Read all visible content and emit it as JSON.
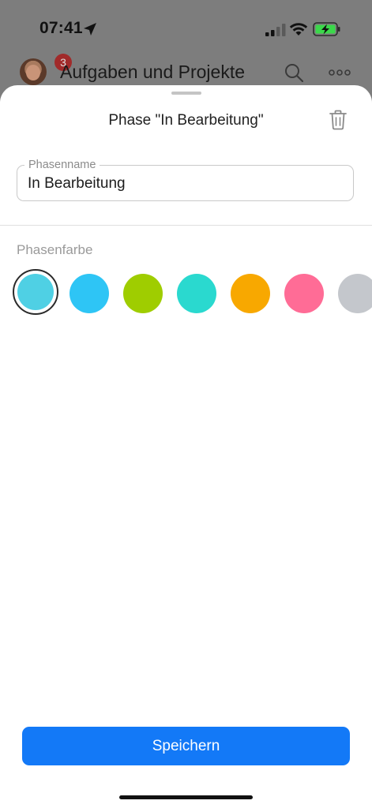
{
  "status_bar": {
    "time": "07:41"
  },
  "background_header": {
    "title": "Aufgaben und Projekte",
    "badge_count": "3"
  },
  "sheet": {
    "title": "Phase \"In Bearbeitung\"",
    "name_field": {
      "label": "Phasenname",
      "value": "In Bearbeitung"
    },
    "color_section": {
      "label": "Phasenfarbe",
      "selected_index": 0,
      "colors": [
        "#4fd0e4",
        "#2ec5f5",
        "#9fcd00",
        "#2ad9cf",
        "#f8a800",
        "#ff6c96",
        "#c4c7cc"
      ]
    },
    "save_label": "Speichern"
  },
  "icons": {
    "location": "location-arrow-icon",
    "signal": "cellular-signal-icon",
    "wifi": "wifi-icon",
    "battery": "battery-charging-icon",
    "search": "search-icon",
    "more": "more-icon",
    "trash": "trash-icon"
  },
  "colors": {
    "accent": "#1379f7",
    "overlay": "#7d7d7d",
    "badge": "#a12a2a",
    "battery_fill": "#3bd84a"
  }
}
